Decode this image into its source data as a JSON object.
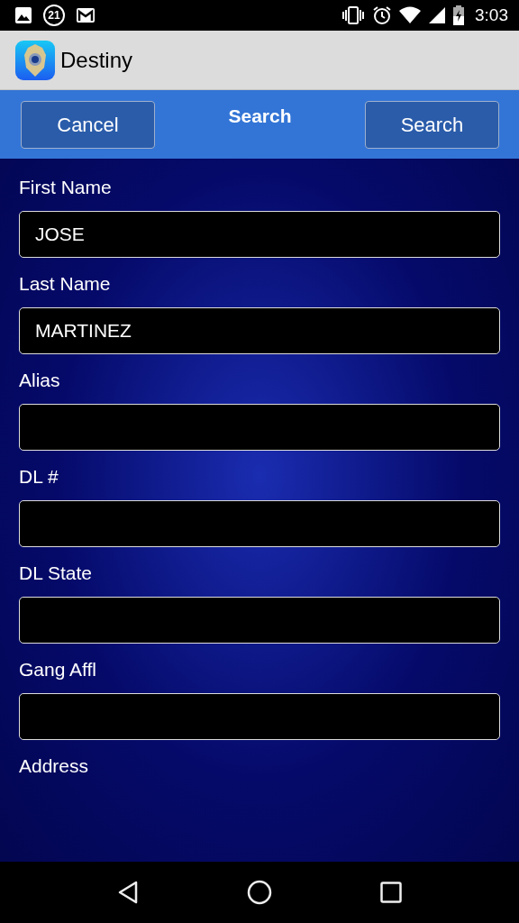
{
  "status_bar": {
    "notification_count": "21",
    "time": "3:03"
  },
  "app_bar": {
    "title": "Destiny"
  },
  "toolbar": {
    "title": "Search",
    "left_button": "Cancel",
    "right_button": "Search"
  },
  "form": {
    "fields": [
      {
        "kind": "text_field",
        "label": "First Name",
        "value": "JOSE"
      },
      {
        "kind": "text_field",
        "label": "Last Name",
        "value": "MARTINEZ"
      },
      {
        "kind": "text_field",
        "label": "Alias"
      },
      {
        "kind": "text_field",
        "label": "DL #"
      },
      {
        "kind": "text_field",
        "label": "DL State"
      },
      {
        "kind": "text_field",
        "label": "Gang Affl"
      },
      {
        "kind": "label",
        "label": "Address"
      }
    ]
  }
}
